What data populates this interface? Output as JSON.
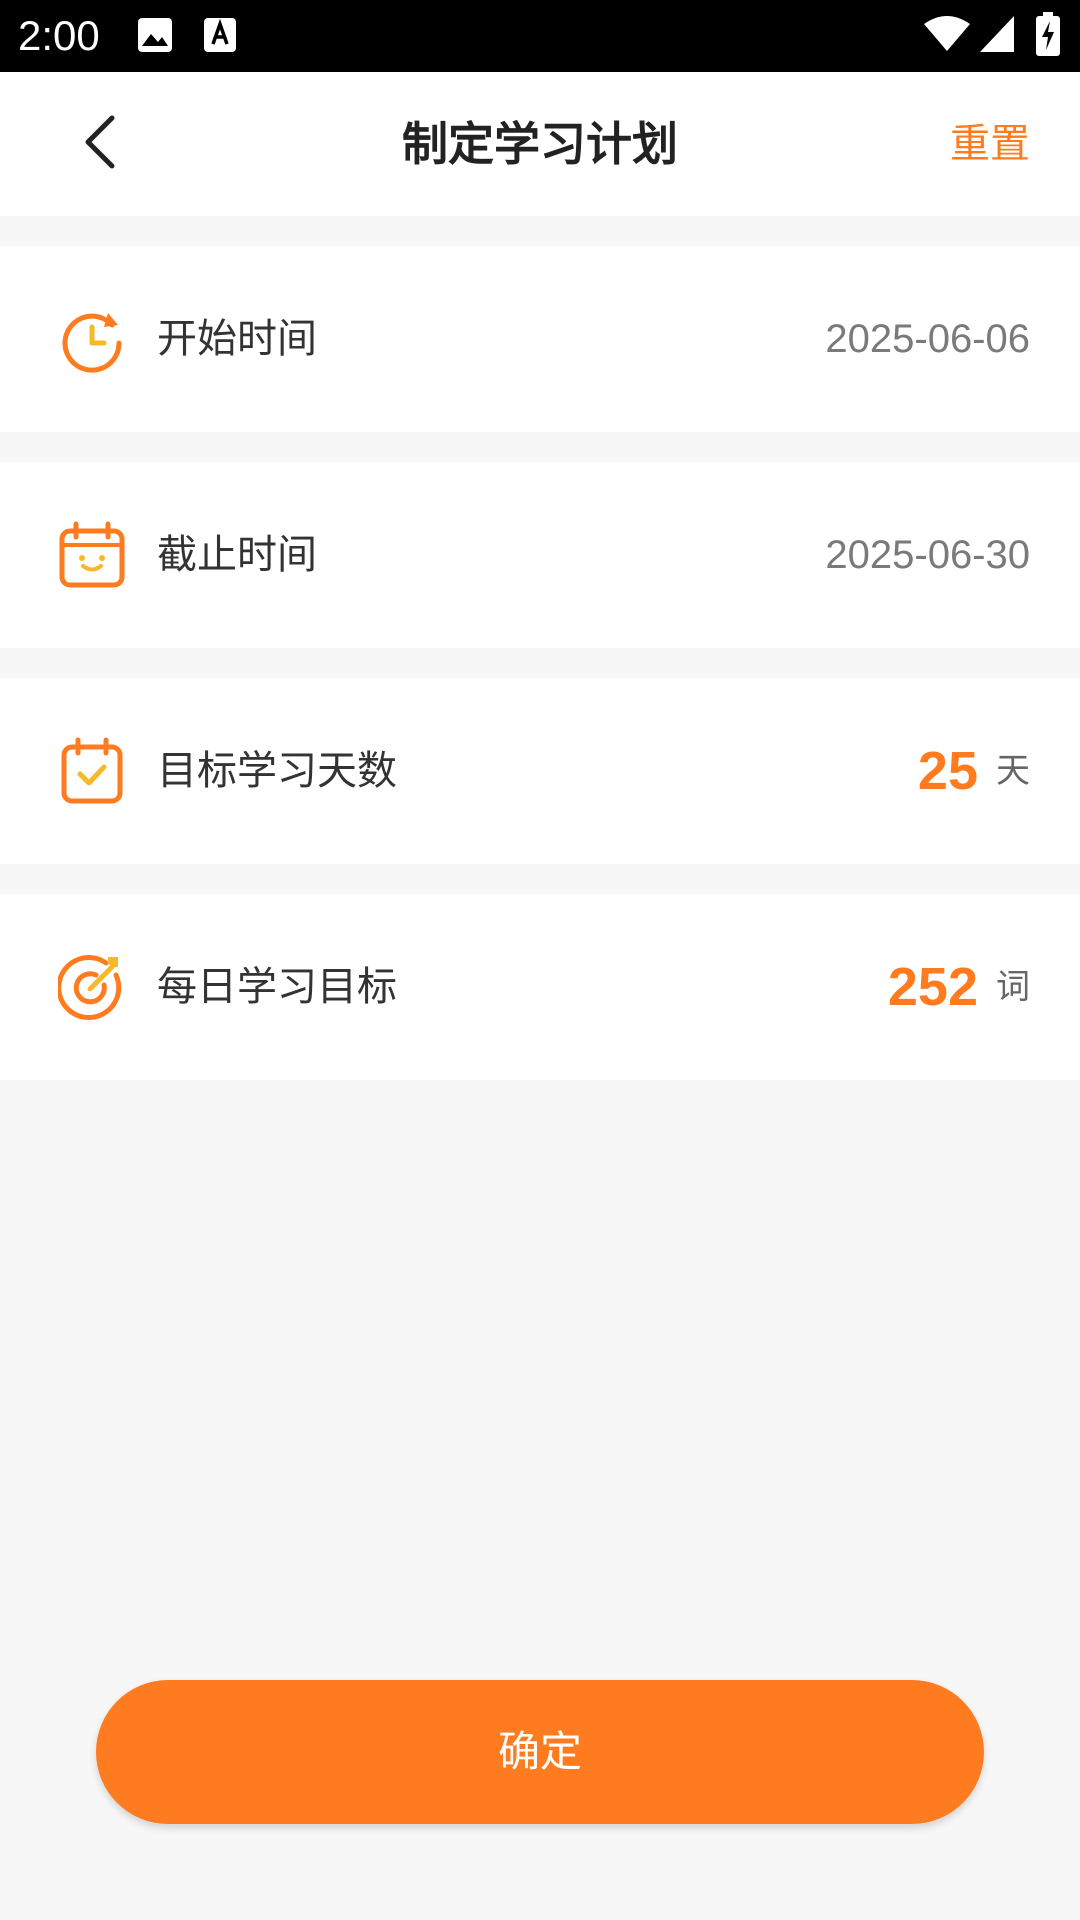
{
  "status_bar": {
    "time": "2:00",
    "icons": [
      "image-icon",
      "text-a-icon",
      "wifi-icon",
      "signal-icon",
      "battery-charging-icon"
    ]
  },
  "header": {
    "title": "制定学习计划",
    "reset_label": "重置",
    "back_icon": "chevron-left-icon"
  },
  "rows": [
    {
      "icon": "clock-icon",
      "label": "开始时间",
      "value": "2025-06-06"
    },
    {
      "icon": "calendar-icon",
      "label": "截止时间",
      "value": "2025-06-30"
    },
    {
      "icon": "calendar-check-icon",
      "label": "目标学习天数",
      "value": "25",
      "unit": "天"
    },
    {
      "icon": "target-icon",
      "label": "每日学习目标",
      "value": "252",
      "unit": "词"
    }
  ],
  "confirm_label": "确定",
  "colors": {
    "accent": "#ff7b1f",
    "icon_yellow": "#f7b928",
    "background": "#f7f7f7",
    "card": "#ffffff",
    "status_bar": "#000000"
  }
}
